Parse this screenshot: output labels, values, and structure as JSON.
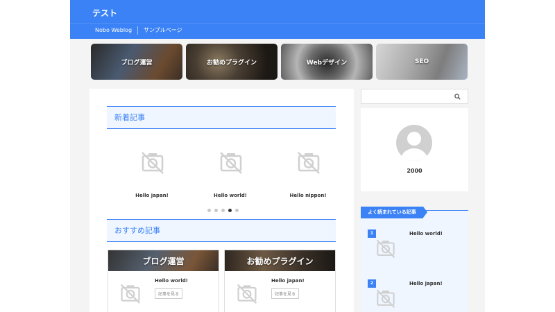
{
  "header": {
    "site_title": "テスト",
    "nav": [
      "Nobo Weblog",
      "サンプルページ"
    ]
  },
  "categories": [
    "ブログ運営",
    "お勧めプラグイン",
    "Webデザイン",
    "SEO"
  ],
  "main": {
    "new_posts_title": "新着記事",
    "slides": [
      "Hello japan!",
      "Hello world!",
      "Hello nippon!"
    ],
    "slider_dots": {
      "count": 5,
      "active_index": 3
    },
    "recommended_title": "おすすめ記事",
    "recommended": [
      {
        "category": "ブログ運営",
        "post_title": "Hello world!",
        "button": "記事を見る"
      },
      {
        "category": "お勧めプラグイン",
        "post_title": "Hello japan!",
        "button": "記事を見る"
      }
    ]
  },
  "sidebar": {
    "search_placeholder": "",
    "profile_name": "2000",
    "popular_title": "よく読まれている記事",
    "popular": [
      {
        "rank": "1",
        "title": "Hello world!"
      },
      {
        "rank": "2",
        "title": "Hello japan!"
      }
    ]
  },
  "colors": {
    "accent": "#3b82f6",
    "accent_light": "#eff6ff"
  }
}
